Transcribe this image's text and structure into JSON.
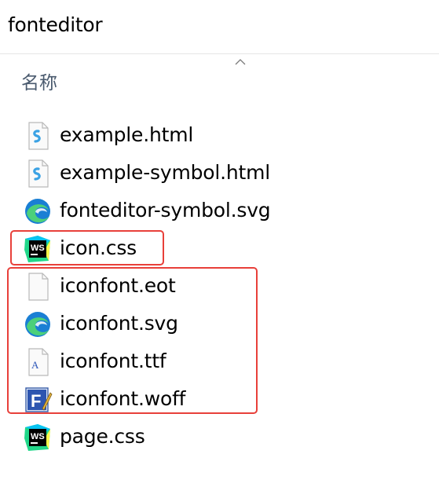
{
  "window": {
    "title": "fonteditor"
  },
  "list": {
    "column_name": "名称",
    "sort": "ascending",
    "files": [
      {
        "name": "example.html",
        "icon": "html-doc-icon"
      },
      {
        "name": "example-symbol.html",
        "icon": "html-doc-icon"
      },
      {
        "name": "fonteditor-symbol.svg",
        "icon": "edge-icon"
      },
      {
        "name": "icon.css",
        "icon": "webstorm-icon"
      },
      {
        "name": "iconfont.eot",
        "icon": "blank-file-icon"
      },
      {
        "name": "iconfont.svg",
        "icon": "edge-icon"
      },
      {
        "name": "iconfont.ttf",
        "icon": "font-file-icon"
      },
      {
        "name": "iconfont.woff",
        "icon": "font-editor-icon"
      },
      {
        "name": "page.css",
        "icon": "webstorm-icon"
      }
    ]
  },
  "highlight_color": "#e8403a"
}
